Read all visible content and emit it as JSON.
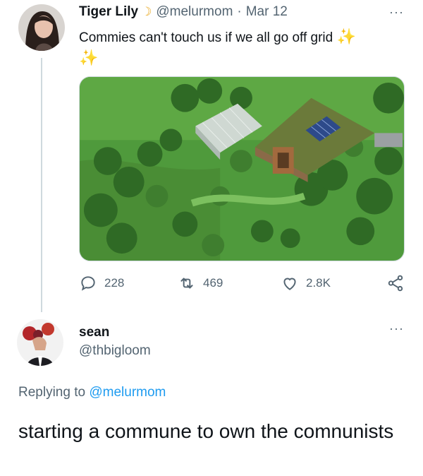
{
  "tweet1": {
    "display_name": "Tiger Lily",
    "name_emoji": "☽",
    "handle": "@melurmom",
    "separator": "·",
    "date": "Mar 12",
    "text": "Commies can't touch us if we all go off grid",
    "sparkle_1": "✨",
    "sparkle_2": "✨",
    "more": "···",
    "replies": "228",
    "retweets": "469",
    "likes": "2.8K",
    "icons": [
      "reply-icon",
      "retweet-icon",
      "like-icon",
      "share-icon"
    ]
  },
  "tweet2": {
    "display_name": "sean",
    "handle": "@thbigloom",
    "more": "···",
    "replying_prefix": "Replying to",
    "replying_to": "@melurmom",
    "text": "starting a commune to own the comnunists"
  },
  "colors": {
    "text": "#0f1419",
    "secondary": "#536471",
    "link": "#1d9bf0",
    "divider": "#cfd9de"
  }
}
